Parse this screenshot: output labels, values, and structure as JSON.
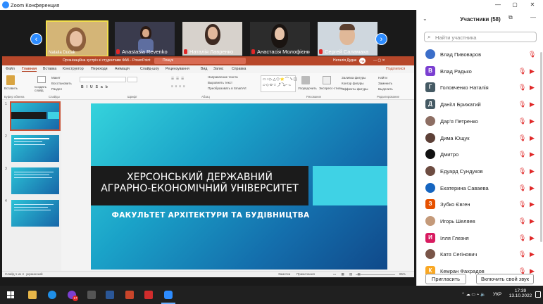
{
  "window": {
    "title": "Zoom Конференция",
    "controls": [
      "—",
      "▢",
      "✕"
    ]
  },
  "gallery": [
    {
      "name": "Natalia Dudak",
      "active": true,
      "bg": "#c8a56a"
    },
    {
      "name": "Anastasia Revenko",
      "active": false,
      "bg": "#3a3b4d"
    },
    {
      "name": "Наталія Лавренко",
      "active": false,
      "bg": "#d7d2cc"
    },
    {
      "name": "Анастасія Молофієнко",
      "active": false,
      "bg": "#2c2c2c"
    },
    {
      "name": "Сергей Саламаха",
      "active": false,
      "bg": "#cfd7de"
    }
  ],
  "ppt": {
    "title": "Організаційна зустріч зі студентами ФАБ  -  PowerPoint",
    "search_placeholder": "Пошук",
    "user": "Наталія Дудак",
    "user_initials": "НД",
    "share": "Поділитися",
    "tabs": [
      "Файл",
      "Главная",
      "Вставка",
      "Конструктор",
      "Переходи",
      "Анімація",
      "Слайд-шоу",
      "Рецензування",
      "Вид",
      "Запис",
      "Справка"
    ],
    "ribbon": {
      "paste": "Вставить",
      "new_slide": "Создать слайд",
      "layout": "Макет",
      "reset": "Восстановить",
      "section": "Раздел",
      "text_direction": "Направление текста",
      "align_text": "Выровнять текст",
      "smartart": "Преобразовать в SmartArt",
      "arrange": "Упорядочить",
      "quick_styles": "Экспресс-стили",
      "shape_fill": "Заливка фигуры",
      "shape_outline": "Контур фигуры",
      "shape_effects": "Эффекты фигуры",
      "find": "Найти",
      "replace": "Заменить",
      "select": "Выделить",
      "groups": [
        "Буфер обмена",
        "Слайды",
        "Шрифт",
        "Абзац",
        "Рисование",
        "Редактирование"
      ]
    },
    "slide_numbers": [
      "1",
      "2",
      "3",
      "4"
    ],
    "slide": {
      "title_line1": "ХЕРСОНСЬКИЙ ДЕРЖАВНИЙ",
      "title_line2": "АГРАРНО-ЕКОНОМІЧНИЙ УНІВЕРСИТЕТ",
      "subtitle": "ФАКУЛЬТЕТ АРХІТЕКТУРИ ТА БУДІВНИЦТВА"
    },
    "status": {
      "slide_of": "Слайд 1 из 4",
      "language": "украинский",
      "notes": "Заметки",
      "comments": "Примечания",
      "zoom": "85%"
    }
  },
  "participants": {
    "header": "Участники (58)",
    "search_placeholder": "Найти участника",
    "list": [
      {
        "name": "Влад Пивоваров",
        "initial": "",
        "color": "#3b6ec9",
        "photo": true,
        "video_icon": false
      },
      {
        "name": "Влад Радько",
        "initial": "В",
        "color": "#7b3fd1",
        "photo": false,
        "video_icon": true
      },
      {
        "name": "Головченко Наталія",
        "initial": "Г",
        "color": "#455a64",
        "photo": false,
        "video_icon": true
      },
      {
        "name": "Даніїл Брижатий",
        "initial": "Д",
        "color": "#455a64",
        "photo": false,
        "video_icon": true
      },
      {
        "name": "Дар'я Петренко",
        "initial": "",
        "color": "#8d6e63",
        "photo": true,
        "video_icon": true
      },
      {
        "name": "Дима Ющук",
        "initial": "",
        "color": "#5d4037",
        "photo": true,
        "video_icon": true
      },
      {
        "name": "Дмитро",
        "initial": "",
        "color": "#111111",
        "photo": true,
        "video_icon": true
      },
      {
        "name": "Едуард Сундуков",
        "initial": "",
        "color": "#6d4c41",
        "photo": true,
        "video_icon": true
      },
      {
        "name": "Екатерина Саваева",
        "initial": "",
        "color": "#1565c0",
        "photo": true,
        "video_icon": true
      },
      {
        "name": "Зубко Євген",
        "initial": "З",
        "color": "#e65100",
        "photo": false,
        "video_icon": true
      },
      {
        "name": "Игорь Шеляев",
        "initial": "",
        "color": "#c49a7a",
        "photo": true,
        "video_icon": true
      },
      {
        "name": "Ілля Глезня",
        "initial": "И",
        "color": "#d81b60",
        "photo": false,
        "video_icon": true
      },
      {
        "name": "Катя Сегінович",
        "initial": "",
        "color": "#795548",
        "photo": true,
        "video_icon": true
      },
      {
        "name": "Кемран Фахрадов",
        "initial": "К",
        "color": "#f9a825",
        "photo": false,
        "video_icon": true
      }
    ],
    "invite": "Пригласить",
    "unmute": "Включить свой звук"
  },
  "taskbar": {
    "time": "17:39",
    "date": "13.10.2022",
    "lang": "УКР",
    "badge": "17"
  }
}
